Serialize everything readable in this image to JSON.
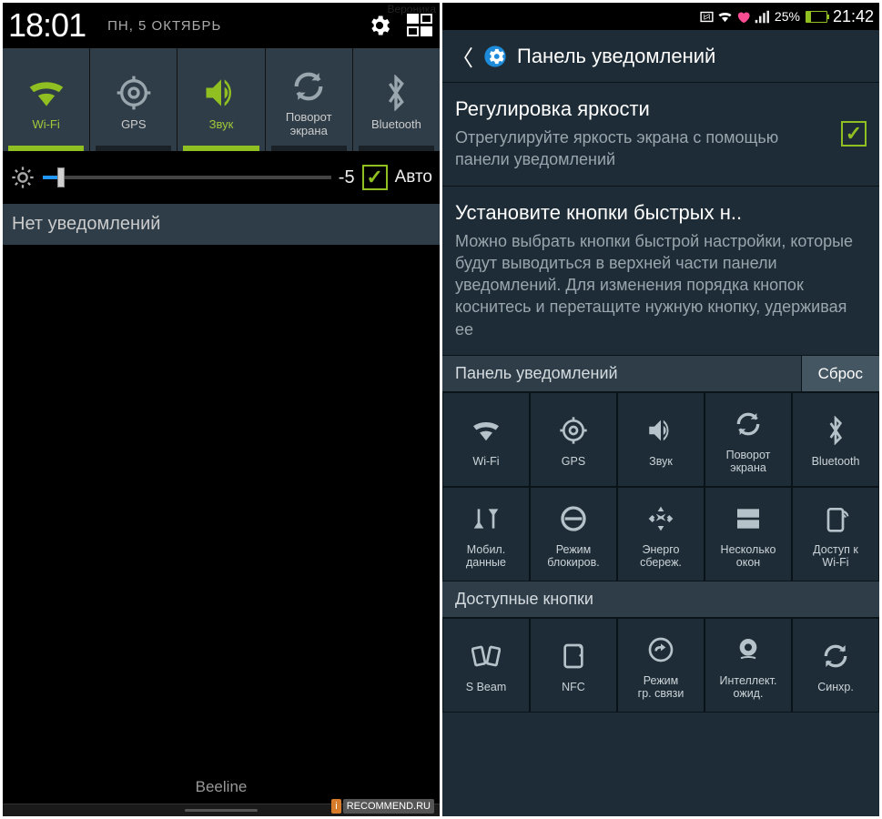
{
  "watermark_top": "Вероника",
  "watermark_brand": "RECOMMEND.RU",
  "left": {
    "clock": "18:01",
    "date": "ПН, 5 ОКТЯБРЬ",
    "toggles": [
      {
        "label": "Wi-Fi",
        "on": true
      },
      {
        "label": "GPS",
        "on": false
      },
      {
        "label": "Звук",
        "on": true
      },
      {
        "label": "Поворот\nэкрана",
        "on": false
      },
      {
        "label": "Bluetooth",
        "on": false
      }
    ],
    "brightness_value": "-5",
    "auto_label": "Авто",
    "no_notifications": "Нет уведомлений",
    "carrier": "Beeline"
  },
  "right": {
    "battery_pct": "25%",
    "clock": "21:42",
    "page_title": "Панель уведомлений",
    "settings": [
      {
        "title": "Регулировка яркости",
        "desc": "Отрегулируйте яркость экрана с помощью панели уведомлений",
        "checked": true
      },
      {
        "title": "Установите кнопки быстрых н..",
        "desc": "Можно выбрать кнопки быстрой настройки, которые будут выводиться в верхней части панели уведомлений. Для изменения порядка кнопок коснитесь и перетащите нужную кнопку, удерживая ее"
      }
    ],
    "panel_header": "Панель уведомлений",
    "reset_btn": "Сброс",
    "available_header": "Доступные кнопки",
    "panel_tiles": [
      "Wi-Fi",
      "GPS",
      "Звук",
      "Поворот\nэкрана",
      "Bluetooth",
      "Мобил.\nданные",
      "Режим\nблокиров.",
      "Энерго\nсбереж.",
      "Несколько\nокон",
      "Доступ к\nWi-Fi"
    ],
    "available_tiles": [
      "S Beam",
      "NFC",
      "Режим\nгр. связи",
      "Интеллект.\nожид.",
      "Синхр."
    ]
  }
}
